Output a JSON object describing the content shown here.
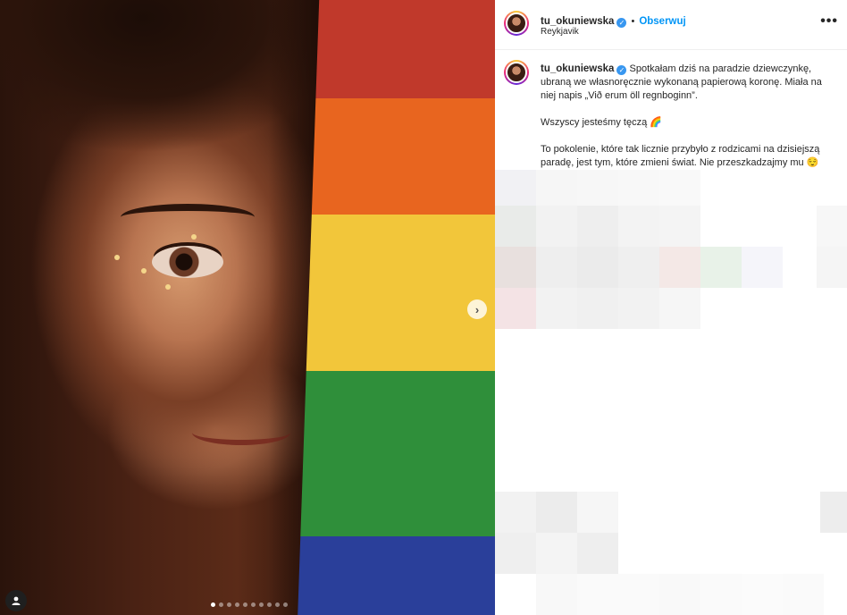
{
  "post": {
    "username": "tu_okuniewska",
    "follow_label": "Obserwuj",
    "separator": "•",
    "location": "Reykjavik",
    "more_label": "•••"
  },
  "caption": {
    "username": "tu_okuniewska",
    "paragraph1": "Spotkałam dziś na paradzie dziewczynkę, ubraną we własnoręcznie wykonaną papierową koronę. Miała na niej napis „Við erum öll regnboginn”.",
    "paragraph2": "Wszyscy jesteśmy tęczą 🌈",
    "paragraph3": "To pokolenie, które tak licznie przybyło z rodzicami na dzisiejszą paradę, jest tym, które zmieni świat. Nie przeszkadzajmy mu 😌"
  },
  "carousel": {
    "next_icon": "chevron-right-icon",
    "slide_count": 10,
    "active_slide": 1
  },
  "colors": {
    "flag": [
      "#c0392b",
      "#e8651f",
      "#f2c63a",
      "#2f8f3a",
      "#2a3f9a"
    ],
    "link": "#0095f6",
    "verified": "#3897f0"
  },
  "icons": {
    "verified": "verified-badge-icon",
    "user_tag": "user-tag-icon",
    "more": "more-options-icon"
  }
}
